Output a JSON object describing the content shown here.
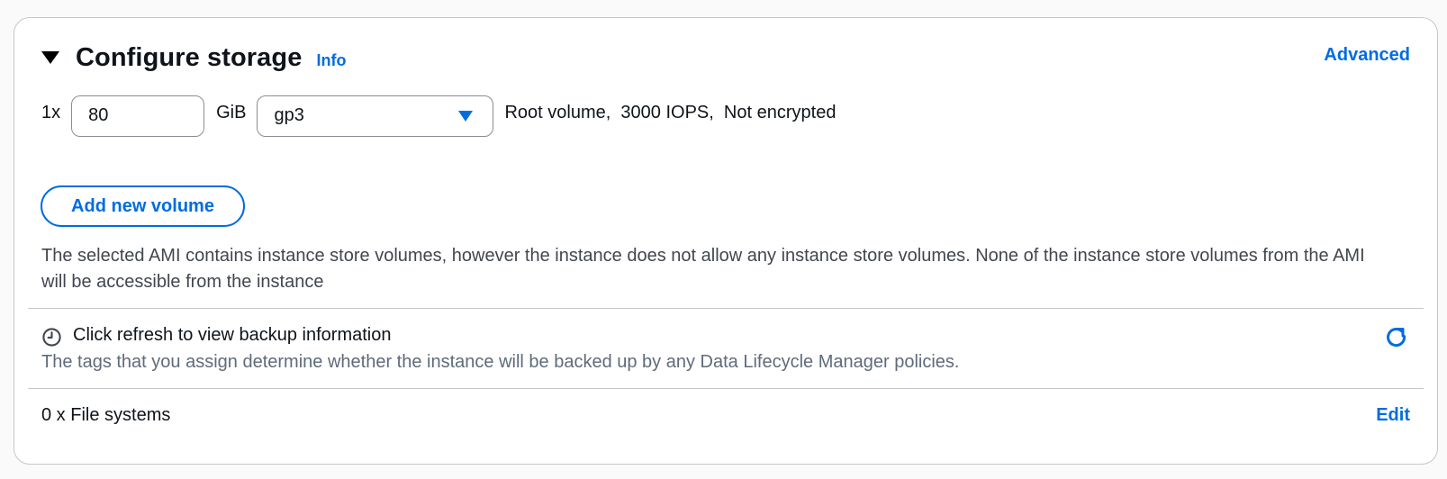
{
  "storage": {
    "title": "Configure storage",
    "info_label": "Info",
    "advanced_label": "Advanced",
    "volume": {
      "multiplier": "1x",
      "size_value": "80",
      "unit": "GiB",
      "type_value": "gp3",
      "description": "Root volume,  3000 IOPS,  Not encrypted"
    },
    "add_volume_label": "Add new volume",
    "warning_text": "The selected AMI contains instance store volumes, however the instance does not allow any instance store volumes. None of the instance store volumes from the AMI will be accessible from the instance"
  },
  "backup": {
    "title": "Click refresh to view backup information",
    "description": "The tags that you assign determine whether the instance will be backed up by any Data Lifecycle Manager policies.",
    "icon": "clock-icon",
    "refresh_icon": "refresh-icon"
  },
  "file_systems": {
    "label": "0 x File systems",
    "edit_label": "Edit"
  },
  "colors": {
    "accent": "#006ce0",
    "border": "#c6c6cd",
    "secondary_text": "#5f6b7a"
  }
}
